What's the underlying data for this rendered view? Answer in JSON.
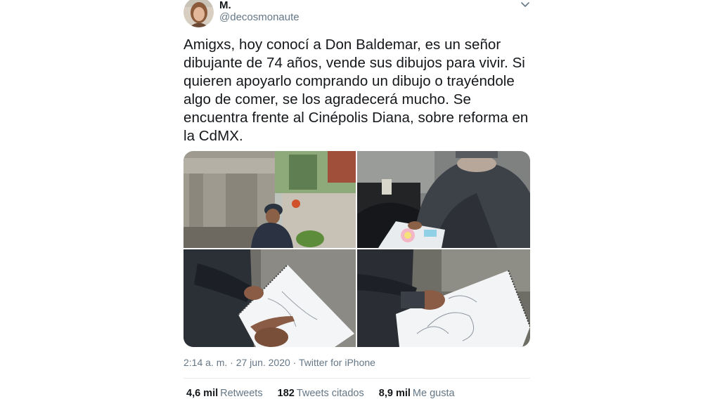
{
  "author": {
    "display_name": "M.",
    "handle": "@decosmonaute"
  },
  "tweet": {
    "text": "Amigxs, hoy conocí a Don Baldemar, es un señor\ndibujante de 74 años, vende sus dibujos para vivir. Si\nquieren apoyarlo comprando un dibujo o trayéndole\nalgo de comer, se los agradecerá mucho. Se\nencuentra frente al Cinépolis Diana, sobre reforma en\nla CdMX."
  },
  "meta": {
    "time": "2:14 a. m.",
    "separator1": " · ",
    "date": "27 jun. 2020",
    "separator2": " · ",
    "source": "Twitter for iPhone"
  },
  "stats": {
    "retweets_count": "4,6 mil",
    "retweets_label": "Retweets",
    "quotes_count": "182",
    "quotes_label": "Tweets citados",
    "likes_count": "8,9 mil",
    "likes_label": "Me gusta"
  },
  "icons": {
    "caret": "chevron-down-icon",
    "avatar": "user-avatar"
  },
  "colors": {
    "primary_text": "#14171a",
    "secondary_text": "#657786",
    "divider": "#e6ecf0"
  }
}
